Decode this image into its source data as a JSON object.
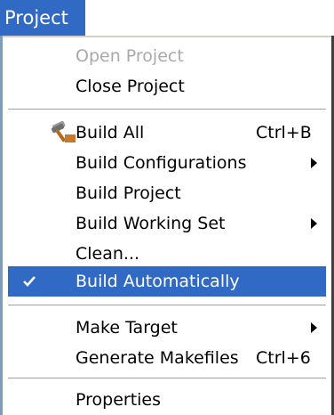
{
  "menubar": {
    "title": "Project"
  },
  "menu": {
    "items": [
      {
        "label": "Open Project",
        "disabled": true
      },
      {
        "label": "Close Project"
      },
      {
        "label": "Build All",
        "shortcut": "Ctrl+B",
        "icon": "hammer-icon"
      },
      {
        "label": "Build Configurations",
        "submenu": true
      },
      {
        "label": "Build Project"
      },
      {
        "label": "Build Working Set",
        "submenu": true
      },
      {
        "label": "Clean..."
      },
      {
        "label": "Build Automatically",
        "checked": true,
        "selected": true
      },
      {
        "label": "Make Target",
        "submenu": true
      },
      {
        "label": "Generate Makefiles",
        "shortcut": "Ctrl+6"
      },
      {
        "label": "Properties"
      }
    ]
  },
  "colors": {
    "selection": "#316ac5",
    "disabled_text": "#a9a9a9"
  }
}
